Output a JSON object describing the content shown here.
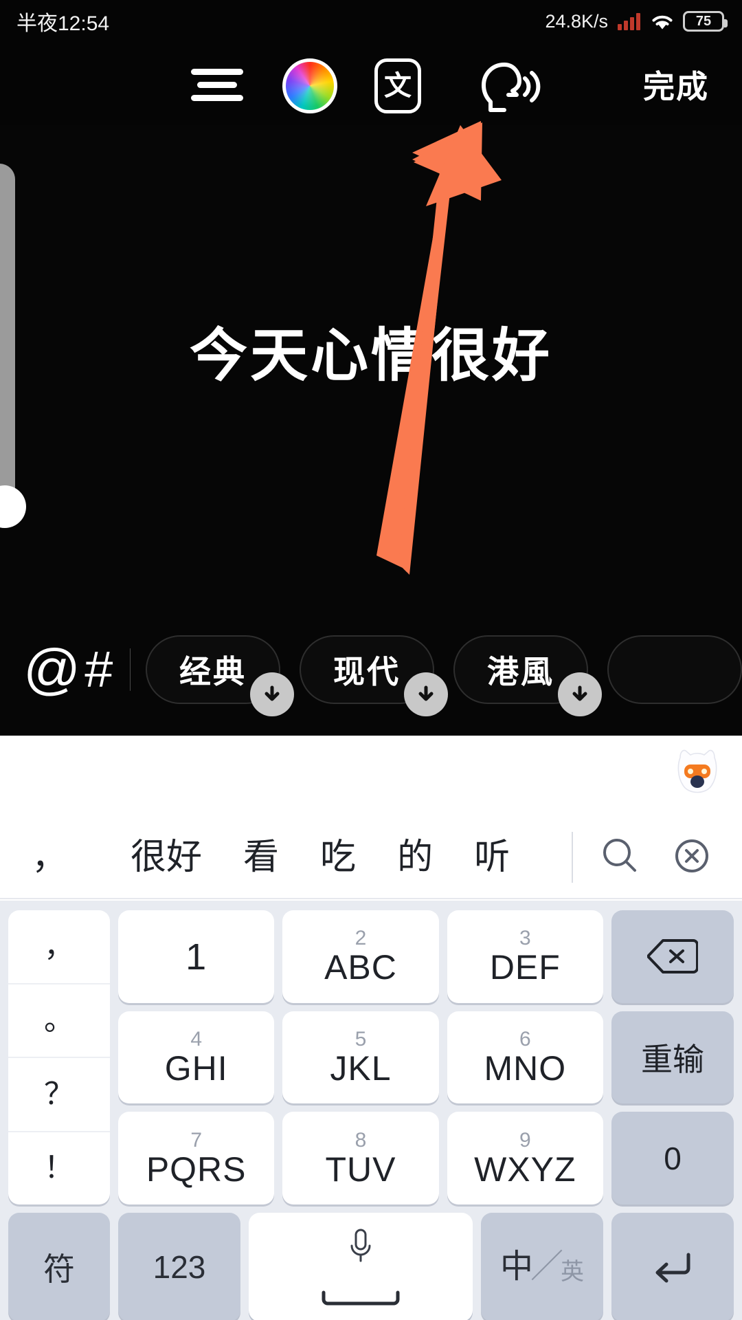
{
  "status_bar": {
    "time": "半夜12:54",
    "network_speed": "24.8K/s",
    "battery_level": "75",
    "signal_icon": "signal-bars-icon",
    "wifi_icon": "wifi-icon",
    "battery_icon": "battery-icon"
  },
  "toolbar": {
    "align_icon": "text-align-icon",
    "color_icon": "color-wheel-icon",
    "font_label": "文",
    "font_icon": "font-style-icon",
    "tts_icon": "text-to-speech-icon",
    "done_label": "完成"
  },
  "canvas": {
    "text": "今天心情很好",
    "side_panel_icon": "side-panel-handle"
  },
  "annotation": {
    "arrow_color": "#fa7a50",
    "arrow_icon": "pointer-arrow-annotation"
  },
  "chip_bar": {
    "mention_label": "@",
    "hashtag_label": "#",
    "chips": [
      {
        "label": "经典",
        "download_icon": "download-arrow-icon"
      },
      {
        "label": "现代",
        "download_icon": "download-arrow-icon"
      },
      {
        "label": "港風",
        "download_icon": "download-arrow-icon"
      },
      {
        "label": "",
        "download_icon": "download-arrow-icon"
      }
    ]
  },
  "keyboard": {
    "mascot_icon": "ime-mascot-icon",
    "candidates": [
      "，",
      "很好",
      "看",
      "吃",
      "的",
      "听"
    ],
    "search_icon": "search-icon",
    "clear_icon": "clear-close-icon",
    "punctuation": [
      "，",
      "。",
      "？",
      "！"
    ],
    "keys": [
      {
        "num": "",
        "label": "1"
      },
      {
        "num": "2",
        "label": "ABC"
      },
      {
        "num": "3",
        "label": "DEF"
      },
      {
        "num": "4",
        "label": "GHI"
      },
      {
        "num": "5",
        "label": "JKL"
      },
      {
        "num": "6",
        "label": "MNO"
      },
      {
        "num": "7",
        "label": "PQRS"
      },
      {
        "num": "8",
        "label": "TUV"
      },
      {
        "num": "9",
        "label": "WXYZ"
      }
    ],
    "function_keys": {
      "backspace_icon": "backspace-icon",
      "redo_label": "重输",
      "zero_label": "0"
    },
    "bottom_row": {
      "symbol_label": "符",
      "numeric_label": "123",
      "space_mic_icon": "microphone-icon",
      "space_icon": "spacebar-icon",
      "lang_zh": "中",
      "lang_slash": "／",
      "lang_en": "英",
      "enter_icon": "enter-return-icon"
    }
  }
}
